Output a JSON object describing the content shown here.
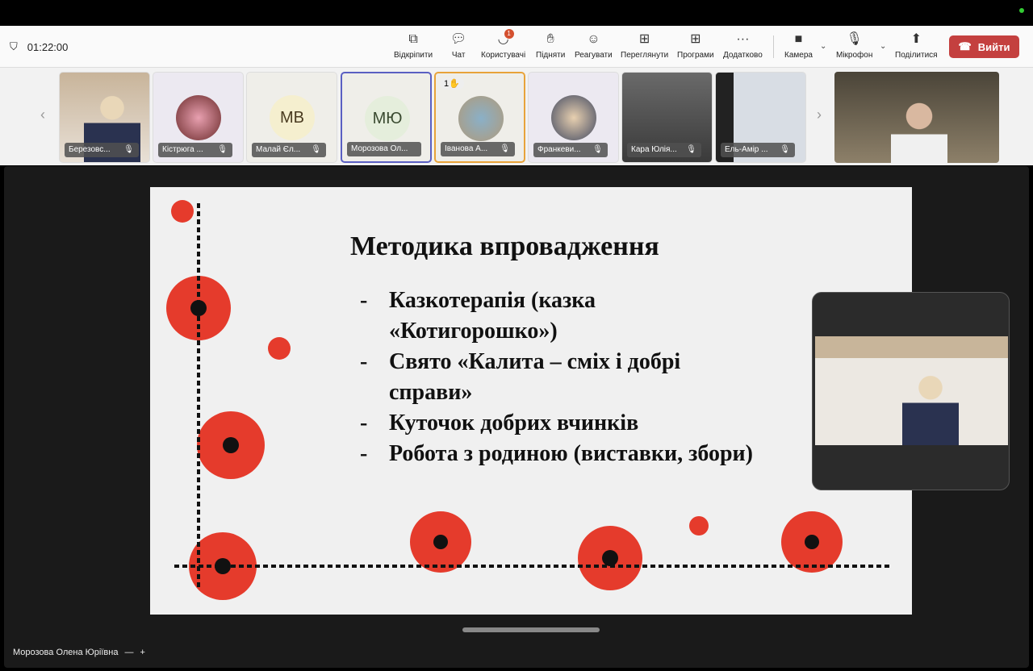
{
  "meeting": {
    "timer": "01:22:00"
  },
  "toolbar": {
    "items": [
      {
        "label": "Відкріпити",
        "icon": "unpin-icon"
      },
      {
        "label": "Чат",
        "icon": "chat-icon"
      },
      {
        "label": "Користувачі",
        "icon": "people-icon",
        "badge": "1"
      },
      {
        "label": "Підняти",
        "icon": "raise-hand-icon"
      },
      {
        "label": "Реагувати",
        "icon": "react-icon"
      },
      {
        "label": "Переглянути",
        "icon": "view-icon"
      },
      {
        "label": "Програми",
        "icon": "apps-icon"
      },
      {
        "label": "Додатково",
        "icon": "more-icon"
      },
      {
        "label": "Камера",
        "icon": "camera-icon"
      },
      {
        "label": "Мікрофон",
        "icon": "microphone-icon"
      },
      {
        "label": "Поділитися",
        "icon": "share-icon"
      }
    ],
    "leave": "Вийти"
  },
  "participants": [
    {
      "name": "Березовс...",
      "type": "video"
    },
    {
      "name": "Кістрюга ...",
      "type": "photo"
    },
    {
      "name": "Малай Єл...",
      "initials": "МВ",
      "color": "#f5efcf"
    },
    {
      "name": "Морозова Ол...",
      "initials": "МЮ",
      "color": "#e5eedc"
    },
    {
      "name": "Іванова А...",
      "type": "photo",
      "hand": "1"
    },
    {
      "name": "Франкеви...",
      "type": "photo"
    },
    {
      "name": "Кара Юлія...",
      "type": "video"
    },
    {
      "name": "Ель-Амір ...",
      "type": "video"
    }
  ],
  "slide": {
    "title": "Методика впровадження",
    "items": [
      "Казкотерапія (казка «Котигорошко»)",
      "Свято «Калита – сміх і добрі справи»",
      "Куточок добрих вчинків",
      "Робота з родиною (виставки, збори)"
    ]
  },
  "footer": {
    "presenter": "Морозова Олена Юріївна",
    "minus": "—",
    "plus": "+"
  }
}
